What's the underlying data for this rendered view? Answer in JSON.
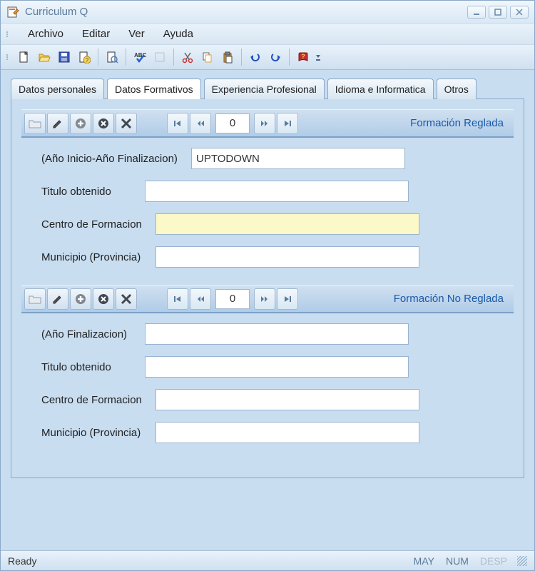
{
  "title": "Curriculum Q",
  "menu": {
    "archivo": "Archivo",
    "editar": "Editar",
    "ver": "Ver",
    "ayuda": "Ayuda"
  },
  "tabs": {
    "datos_personales": "Datos personales",
    "datos_formativos": "Datos Formativos",
    "experiencia": "Experiencia Profesional",
    "idioma": "Idioma e Informatica",
    "otros": "Otros"
  },
  "sections": {
    "reglada": {
      "title": "Formación Reglada",
      "counter": "0",
      "fields": {
        "ano": {
          "label": "(Año Inicio-Año Finalizacion)",
          "value": "UPTODOWN"
        },
        "titulo": {
          "label": "Titulo obtenido",
          "value": ""
        },
        "centro": {
          "label": "Centro de Formacion",
          "value": ""
        },
        "municipio": {
          "label": "Municipio (Provincia)",
          "value": ""
        }
      }
    },
    "noreglada": {
      "title": "Formación No  Reglada",
      "counter": "0",
      "fields": {
        "ano": {
          "label": "(Año Finalizacion)",
          "value": ""
        },
        "titulo": {
          "label": "Titulo obtenido",
          "value": ""
        },
        "centro": {
          "label": "Centro de Formacion",
          "value": ""
        },
        "municipio": {
          "label": "Municipio (Provincia)",
          "value": ""
        }
      }
    }
  },
  "status": {
    "text": "Ready",
    "may": "MAY",
    "num": "NUM",
    "desp": "DESP"
  }
}
